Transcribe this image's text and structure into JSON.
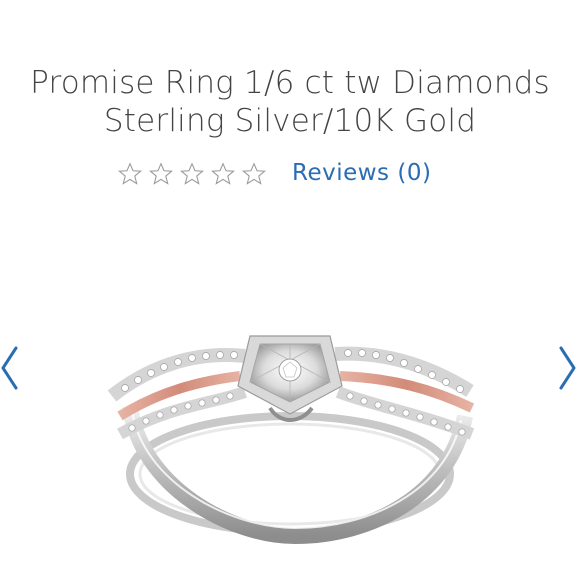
{
  "product": {
    "title_line1": "Promise Ring 1/6 ct tw Diamonds",
    "title_line2": "Sterling Silver/10K Gold"
  },
  "rating": {
    "stars_filled": 0,
    "stars_total": 5,
    "reviews_label": "Reviews (0)"
  },
  "carousel": {
    "prev_icon": "chevron-left-icon",
    "next_icon": "chevron-right-icon"
  },
  "colors": {
    "accent": "#2a6db3",
    "title": "#444444",
    "star_outline": "#9a9a9a",
    "rose_gold": "#d99a8a"
  }
}
